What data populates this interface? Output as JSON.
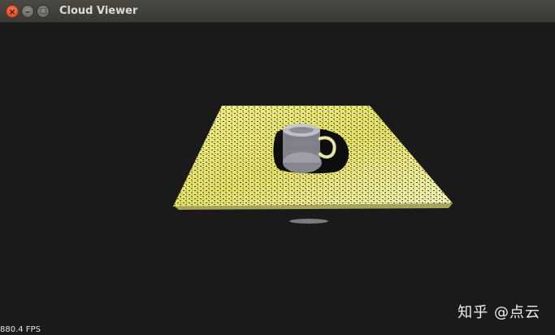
{
  "window": {
    "title": "Cloud Viewer",
    "buttons": {
      "close": "×",
      "minimize": "–",
      "maximize": "□"
    }
  },
  "viewport": {
    "fps_text": "880.4 FPS",
    "scene_colors": {
      "background": "#1a1a1a",
      "plane": "#e8e66a",
      "mug": "#b9b9c4"
    }
  },
  "watermark": {
    "text": "知乎 @点云"
  }
}
